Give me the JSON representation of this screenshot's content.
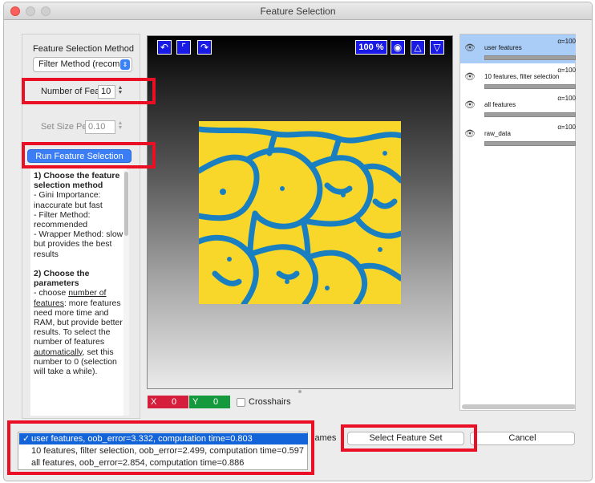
{
  "window": {
    "title": "Feature Selection"
  },
  "left": {
    "method_label": "Feature Selection Method",
    "method_value": "Filter Method (recomm",
    "num_label": "Number of Fea",
    "num_value": "10",
    "setsize_label": "Set Size Pe",
    "setsize_value": "0.10",
    "run_button": "Run Feature Selection"
  },
  "help": {
    "h1": "1) Choose the feature selection method",
    "p1a": "- Gini Importance: inaccurate but fast",
    "p1b": "- Filter Method: recommended",
    "p1c": "- Wrapper Method: slow but provides the best results",
    "h2": "2) Choose the parameters",
    "p2a": "- choose ",
    "p2u1": "number of features",
    "p2b": ": more features need more time and RAM, but provide better results. To select the number of features ",
    "p2u2": "automatically",
    "p2c": ", set this number to 0 (selection will take a while)."
  },
  "viewer": {
    "zoom": "100 %",
    "x_label": "X",
    "x_value": "0",
    "y_label": "Y",
    "y_value": "0",
    "crosshairs": "Crosshairs",
    "colors": {
      "foreground": "#f8d72a",
      "background": "#1a7fc0"
    }
  },
  "layers": [
    {
      "name": "user features",
      "alpha": "α=100",
      "selected": true
    },
    {
      "name": "10 features, filter selection",
      "alpha": "α=100",
      "selected": false
    },
    {
      "name": "all features",
      "alpha": "α=100",
      "selected": false
    },
    {
      "name": "raw_data",
      "alpha": "α=100",
      "selected": false
    }
  ],
  "results": [
    "user features, oob_error=3.332, computation time=0.803",
    "10 features, filter selection, oob_error=2.499, computation time=0.597",
    "all features, oob_error=2.854, computation time=0.886"
  ],
  "bottom": {
    "names_fragment": "lames",
    "select_button": "Select Feature Set",
    "cancel_button": "Cancel"
  }
}
